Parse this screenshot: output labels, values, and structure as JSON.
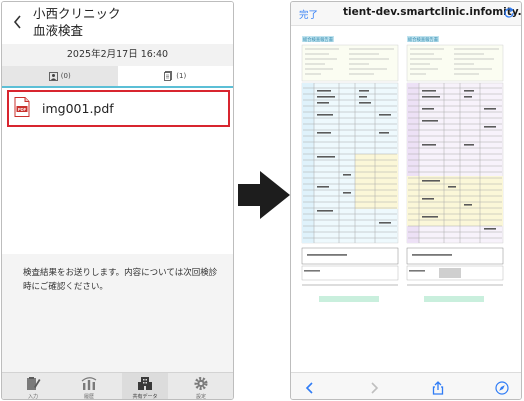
{
  "left_screen": {
    "back_label": "",
    "clinic_name": "小西クリニック",
    "subtitle": "血液検査",
    "datetime": "2025年2月17日 16:40",
    "tabs": [
      {
        "label": "(0)",
        "icon": "person-icon"
      },
      {
        "label": "(1)",
        "icon": "document-icon"
      }
    ],
    "file": {
      "name": "img001.pdf",
      "icon": "pdf-icon"
    },
    "message": "検査結果をお送りします。内容については次回検診時にご確認ください。",
    "tabbar": [
      {
        "label": "入力",
        "icon": "input-icon"
      },
      {
        "label": "履歴",
        "icon": "history-icon"
      },
      {
        "label": "共有データ",
        "icon": "building-icon",
        "active": true
      },
      {
        "label": "設定",
        "icon": "gear-icon"
      }
    ]
  },
  "right_screen": {
    "done_label": "完了",
    "url": "tient-dev.smartclinic.infomity.jp",
    "document": {
      "report_title": "総合検査報告書",
      "report_title_2": "総合検査報告書"
    }
  },
  "colors": {
    "accent": "#5bbfd6",
    "highlight_border": "#d8252f",
    "ios_blue": "#2f7cf6"
  }
}
